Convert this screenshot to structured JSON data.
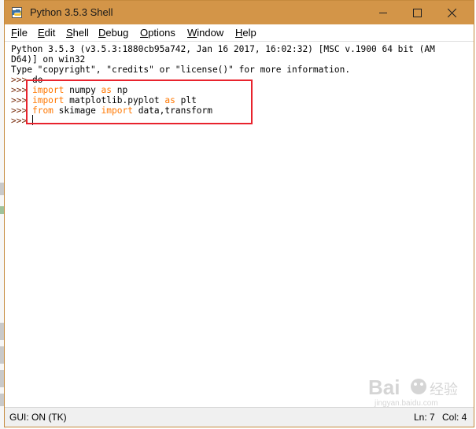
{
  "window": {
    "title": "Python 3.5.3 Shell",
    "controls": [
      "minimize",
      "maximize",
      "close"
    ]
  },
  "menu": {
    "items": [
      {
        "label": "File",
        "mnemonic": "F",
        "rest": "ile"
      },
      {
        "label": "Edit",
        "mnemonic": "E",
        "rest": "dit"
      },
      {
        "label": "Shell",
        "mnemonic": "S",
        "rest": "hell"
      },
      {
        "label": "Debug",
        "mnemonic": "D",
        "rest": "ebug"
      },
      {
        "label": "Options",
        "mnemonic": "O",
        "rest": "ptions"
      },
      {
        "label": "Window",
        "mnemonic": "W",
        "rest": "indow"
      },
      {
        "label": "Help",
        "mnemonic": "H",
        "rest": "elp"
      }
    ]
  },
  "shell": {
    "banner": [
      "Python 3.5.3 (v3.5.3:1880cb95a742, Jan 16 2017, 16:02:32) [MSC v.1900 64 bit (AM",
      "D64)] on win32",
      "Type \"copyright\", \"credits\" or \"license()\" for more information."
    ],
    "prompt": ">>>",
    "lines": [
      {
        "code": " do"
      },
      {
        "kw1": "import",
        "mid": " numpy ",
        "kw2": "as",
        "end": " np"
      },
      {
        "kw1": "import",
        "mid": " matplotlib.pyplot ",
        "kw2": "as",
        "end": " plt"
      },
      {
        "kw1": "from",
        "mid": " skimage ",
        "kw2": "import",
        "end": " data,transform"
      }
    ]
  },
  "status": {
    "gui": "GUI: ON (TK)",
    "line": "Ln: 7",
    "col": "Col: 4"
  },
  "colors": {
    "titlebar": "#d39548",
    "keyword": "#ff7700",
    "prompt": "#7a2f0f",
    "highlight": "#e8232d"
  },
  "watermark": {
    "brand": "Bai",
    "brand_cn": "经验",
    "url": "jingyan.baidu.com"
  }
}
